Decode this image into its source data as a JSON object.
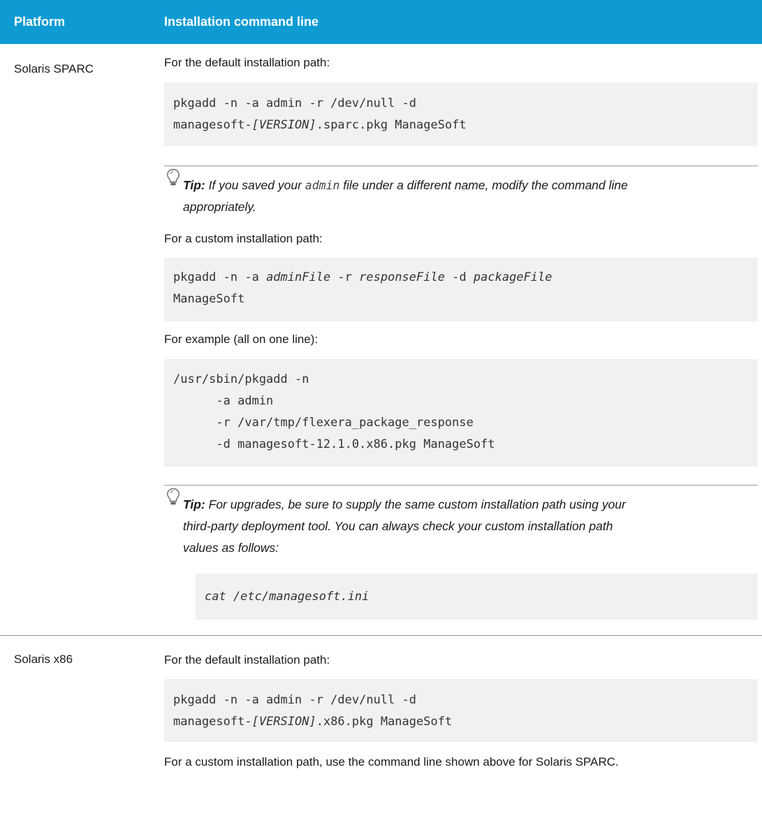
{
  "header": {
    "platform": "Platform",
    "command": "Installation command line"
  },
  "rows": [
    {
      "platform": "Solaris SPARC",
      "default_intro": "For the default installation path:",
      "default_code": {
        "l1": "pkgadd -n -a admin -r /dev/null -d",
        "l2_pre": "managesoft-",
        "l2_var": "[VERSION]",
        "l2_post": ".sparc.pkg ManageSoft"
      },
      "tip1": {
        "label": "Tip:",
        "t1": " If you saved your ",
        "mono": "admin",
        "t2": " file under a different name, modify the command line",
        "t3": "appropriately."
      },
      "custom_intro": "For a custom installation path:",
      "custom_code": {
        "pre": "pkgadd -n -a ",
        "a": "adminFile",
        "mid1": " -r ",
        "b": "responseFile",
        "mid2": " -d ",
        "c": "packageFile",
        "l2": "ManageSoft"
      },
      "example_intro": "For example (all on one line):",
      "example_code": [
        "/usr/sbin/pkgadd -n",
        "      -a admin",
        "      -r /var/tmp/flexera_package_response",
        "      -d managesoft-12.1.0.x86.pkg ManageSoft"
      ],
      "tip2": {
        "label": "Tip:",
        "l1": " For upgrades, be sure to supply the same custom installation path using your",
        "l2": "third-party deployment tool. You can always check your custom installation path",
        "l3": "values as follows:",
        "code": "cat /etc/managesoft.ini"
      }
    },
    {
      "platform": "Solaris x86",
      "default_intro": "For the default installation path:",
      "default_code": {
        "l1": "pkgadd -n -a admin -r /dev/null -d",
        "l2_pre": "managesoft-",
        "l2_var": "[VERSION]",
        "l2_post": ".x86.pkg ManageSoft"
      },
      "custom_note": "For a custom installation path, use the command line shown above for Solaris SPARC."
    }
  ],
  "icons": {
    "tip": "lightbulb-icon"
  }
}
